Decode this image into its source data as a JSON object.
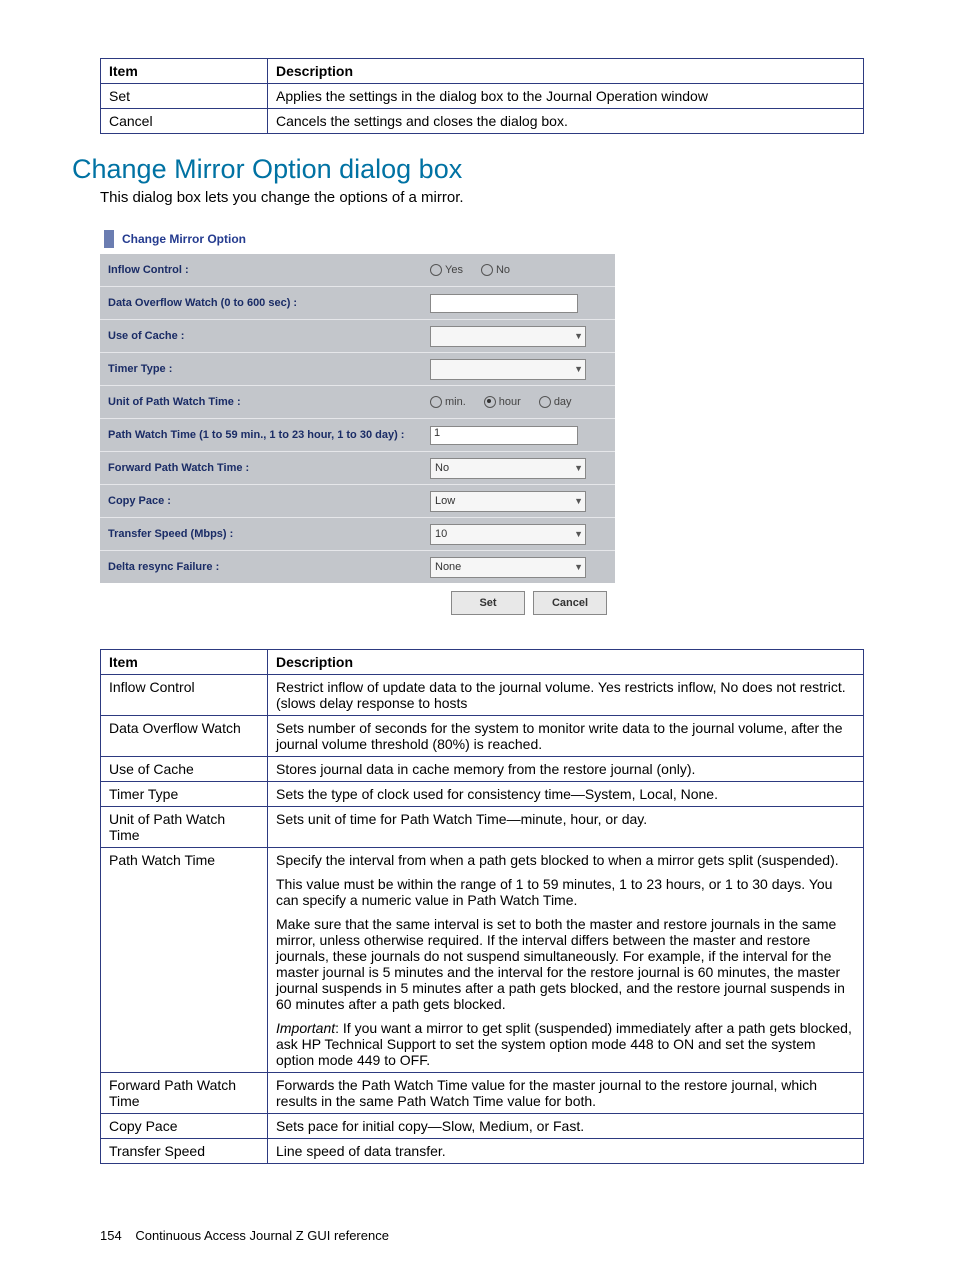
{
  "table1": {
    "headers": [
      "Item",
      "Description"
    ],
    "rows": [
      {
        "item": "Set",
        "desc": "Applies the settings in the dialog box to the Journal Operation window"
      },
      {
        "item": "Cancel",
        "desc": "Cancels the settings and closes the dialog box."
      }
    ]
  },
  "section_title": "Change Mirror Option dialog box",
  "intro": "This dialog box lets you change the options of a mirror.",
  "dialog": {
    "title": "Change Mirror Option",
    "rows": {
      "inflow_control": "Inflow Control :",
      "yes": "Yes",
      "no": "No",
      "data_overflow": "Data Overflow Watch (0 to 600 sec) :",
      "use_of_cache": "Use of Cache :",
      "timer_type": "Timer Type :",
      "unit_pwt": "Unit of Path Watch Time :",
      "min": "min.",
      "hour": "hour",
      "day": "day",
      "pwt": "Path Watch Time (1 to 59 min., 1 to 23 hour, 1 to 30 day) :",
      "pwt_val": "1",
      "fpwt": "Forward Path Watch Time :",
      "fpwt_val": "No",
      "copy_pace": "Copy Pace :",
      "copy_pace_val": "Low",
      "transfer_speed": "Transfer Speed (Mbps) :",
      "transfer_speed_val": "10",
      "delta": "Delta resync Failure :",
      "delta_val": "None"
    },
    "buttons": {
      "set": "Set",
      "cancel": "Cancel"
    }
  },
  "table2": {
    "headers": [
      "Item",
      "Description"
    ],
    "rows": [
      {
        "item": "Inflow Control",
        "desc": "Restrict inflow of update data to the journal volume. Yes restricts inflow, No does not restrict. (slows delay response to hosts"
      },
      {
        "item": "Data Overflow Watch",
        "desc": "Sets number of seconds for the system to monitor write data to the journal volume, after the journal volume threshold (80%) is reached."
      },
      {
        "item": "Use of Cache",
        "desc": "Stores journal data in cache memory from the restore journal (only)."
      },
      {
        "item": "Timer Type",
        "desc": "Sets the type of clock used for consistency time—System, Local, None."
      },
      {
        "item": "Unit of Path Watch Time",
        "desc": "Sets unit of time for Path Watch Time—minute, hour, or day."
      },
      {
        "item": "Path Watch Time",
        "multi": [
          "Specify the interval from when a path gets blocked to when a mirror gets split (suspended).",
          "This value must be within the range of 1 to 59 minutes, 1 to 23 hours, or 1 to 30 days. You can specify a numeric value in Path Watch Time.",
          "Make sure that the same interval is set to both the master and restore journals in the same mirror, unless otherwise required. If the interval differs between the master and restore journals, these journals do not suspend simultaneously. For example, if the interval for the master journal is 5 minutes and the interval for the restore journal is 60 minutes, the master journal suspends in 5 minutes after a path gets blocked, and the restore journal suspends in 60 minutes after a path gets blocked."
        ],
        "important_prefix": "Important",
        "important_text": ": If you want a mirror to get split (suspended) immediately after a path gets blocked, ask HP Technical Support to set the system option mode 448 to ON and set the system option mode 449 to OFF."
      },
      {
        "item": "Forward Path Watch Time",
        "desc": "Forwards the Path Watch Time value for the master journal to the restore journal, which results in the same Path Watch Time value for both."
      },
      {
        "item": "Copy Pace",
        "desc": "Sets pace for initial copy—Slow, Medium, or Fast."
      },
      {
        "item": "Transfer Speed",
        "desc": "Line speed of data transfer."
      }
    ]
  },
  "footer": {
    "page_number": "154",
    "title": "Continuous Access Journal Z GUI reference"
  }
}
